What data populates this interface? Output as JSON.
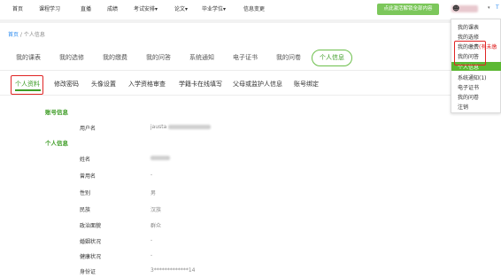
{
  "topnav": {
    "items": [
      "首页",
      "课程学习",
      "直播",
      "成绩",
      "考试安排▾",
      "论文▾",
      "毕业学位▾",
      "信息变更"
    ],
    "promo_label": "点此激活解锁全部内容",
    "chevron": "▾",
    "tail_char": "T"
  },
  "breadcrumb": {
    "home": "首页",
    "separator": " / ",
    "current": "个人信息"
  },
  "main_tabs": [
    "我的课表",
    "我的选修",
    "我的缴费",
    "我的问答",
    "系统通知",
    "电子证书",
    "我的问卷",
    "个人信息"
  ],
  "sub_tabs": [
    "个人资料",
    "修改密码",
    "头像设置",
    "入学资格审查",
    "学籍卡在线填写",
    "父母或监护人信息",
    "账号绑定"
  ],
  "account_section": {
    "title": "账号信息",
    "rows": [
      {
        "label": "用户名",
        "value": "jausta"
      }
    ]
  },
  "personal_section": {
    "title": "个人信息",
    "rows": [
      {
        "label": "姓名",
        "value": ""
      },
      {
        "label": "曾用名",
        "value": "-"
      },
      {
        "label": "性别",
        "value": "男"
      },
      {
        "label": "民族",
        "value": "汉族"
      },
      {
        "label": "政治面貌",
        "value": "群众"
      },
      {
        "label": "婚姻状况",
        "value": "-"
      },
      {
        "label": "健康状况",
        "value": "-"
      },
      {
        "label": "身份证",
        "value": "3*************14"
      }
    ]
  },
  "dropdown": {
    "items": [
      {
        "label": "我的课表",
        "suffix": ""
      },
      {
        "label": "我的选修",
        "suffix": ""
      },
      {
        "label": "我的缴费",
        "suffix": "(有未缴"
      },
      {
        "label": "我的问答",
        "suffix": ""
      },
      {
        "label": "个人信息",
        "suffix": ""
      },
      {
        "label": "系统通知(1)",
        "suffix": ""
      },
      {
        "label": "电子证书",
        "suffix": ""
      },
      {
        "label": "我的问卷",
        "suffix": ""
      },
      {
        "label": "注销",
        "suffix": ""
      }
    ]
  },
  "colors": {
    "accent": "#3f9d27",
    "highlight_border": "#e02424",
    "menu_active": "#5cb833",
    "promo": "#7cc75b"
  }
}
